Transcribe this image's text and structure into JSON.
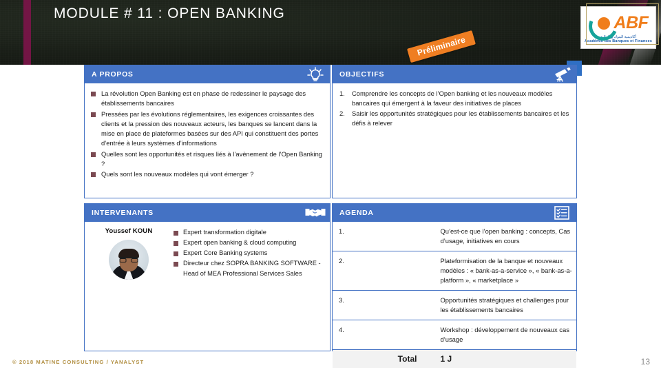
{
  "slide": {
    "title": "MODULE # 11 : OPEN BANKING",
    "ribbon_label": "Préliminaire",
    "page_number": "13",
    "footer": "© 2018 MATINE CONSULTING / YANALYST"
  },
  "logo": {
    "wordmark": "ABF",
    "arabic_line": "أكاديمية البنوك و المالية",
    "french_line": "Académie des Banques et Finances"
  },
  "colors": {
    "panel_blue": "#4472C4",
    "ribbon_orange": "#EF7E22",
    "banner_dark": "#1C2119",
    "magenta_stripe": "#7B1549",
    "bullet_maroon": "#7B4A52",
    "footer_gold": "#B08D3F",
    "logo_orange": "#F07D1A",
    "logo_teal": "#17A39B"
  },
  "panels": {
    "apropos": {
      "title": "A PROPOS",
      "icon": "lightbulb-icon",
      "bullets": [
        "La révolution Open Banking est en phase de redessiner le paysage des établissements bancaires",
        "Pressées par les évolutions réglementaires, les exigences croissantes des clients et la pression des nouveaux acteurs, les banques se lancent dans la mise en place de plateformes basées sur des API qui constituent des portes d’entrée à leurs systèmes d’informations",
        "Quelles sont les opportunités et risques liés à l’avènement de l’Open Banking ?",
        "Quels sont les nouveaux modèles qui vont émerger ?"
      ]
    },
    "objectifs": {
      "title": "OBJECTIFS",
      "icon": "telescope-icon",
      "items": [
        "Comprendre les concepts de l’Open banking et les nouveaux modèles bancaires qui émergent à la faveur des initiatives de places",
        "Saisir les opportunités stratégiques pour les établissements bancaires et les défis à relever"
      ]
    },
    "intervenants": {
      "title": "INTERVENANTS",
      "icon": "handshake-icon",
      "speaker_name": "Youssef KOUN",
      "avatar": "speaker-photo",
      "bullets": [
        "Expert transformation digitale",
        "Expert open banking & cloud computing",
        "Expert Core Banking systems",
        "Directeur chez SOPRA BANKING SOFTWARE - Head of MEA Professional Services Sales"
      ]
    },
    "agenda": {
      "title": "AGENDA",
      "icon": "checklist-icon",
      "rows": [
        {
          "num": "1.",
          "text": "Qu’est-ce que l’open banking : concepts, Cas d’usage, initiatives en cours"
        },
        {
          "num": "2.",
          "text": "Plateformisation de la banque et nouveaux modèles : « bank-as-a-service », « bank-as-a-platform », « marketplace »"
        },
        {
          "num": "3.",
          "text": "Opportunités stratégiques et challenges pour les établissements bancaires"
        },
        {
          "num": "4.",
          "text": "Workshop : développement de nouveaux cas d’usage"
        }
      ],
      "total_label": "Total",
      "total_value": "1 J"
    }
  }
}
